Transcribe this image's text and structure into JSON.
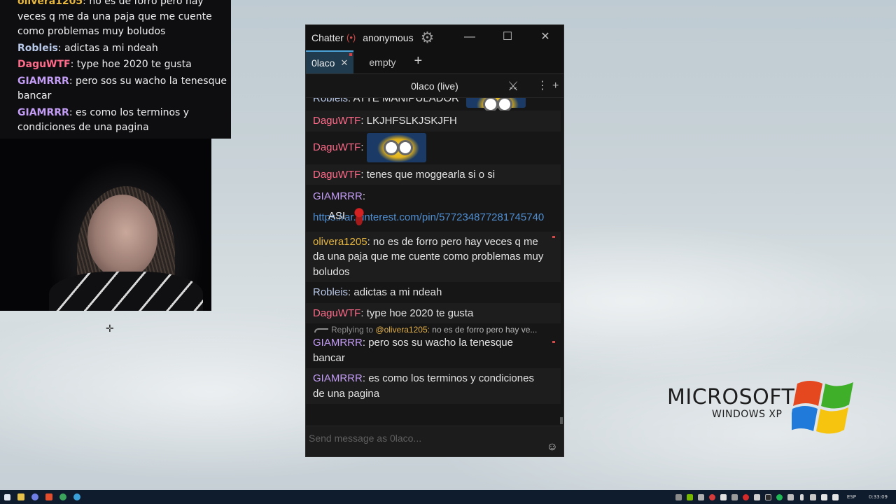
{
  "overlay": {
    "messages": [
      {
        "user": "olivera1205",
        "color": "#e6b63e",
        "sep": ": ",
        "text": "no es de forro pero hay veces q me da una paja que me cuente como problemas muy boludos"
      },
      {
        "user": "Robleis",
        "color": "#b8c8e8",
        "sep": ": ",
        "text": "adictas a mi ndeah"
      },
      {
        "user": "DaguWTF",
        "color": "#ff6b8a",
        "sep": ": ",
        "text": "type hoe 2020 te gusta"
      },
      {
        "user": "GIAMRRR",
        "color": "#c39cf5",
        "sep": ": ",
        "text": "pero sos su wacho la tenesque bancar"
      },
      {
        "user": "GIAMRRR",
        "color": "#c39cf5",
        "sep": ": ",
        "text": "es como los terminos y condiciones de una pagina"
      }
    ]
  },
  "window": {
    "app_name": "Chatterino",
    "user": "anonymous",
    "minimize": "—",
    "maximize": "☐",
    "close": "✕"
  },
  "tabs": [
    {
      "label": "0laco",
      "close": "✕"
    },
    {
      "label": "empty"
    }
  ],
  "add_tab": "+",
  "split": {
    "title": "0laco (live)",
    "more": "⋮",
    "add": "+"
  },
  "messages": {
    "cut": {
      "user": "Robleis",
      "sep": ": ",
      "text": "ATTE MANIPULADOR",
      "color": "#b8c8e8"
    },
    "m1": {
      "user": "DaguWTF",
      "sep": ": ",
      "text": "LKJHFSLKJSKJFH",
      "color": "#ff6b8a"
    },
    "m2": {
      "user": "DaguWTF",
      "sep": ": ",
      "color": "#ff6b8a"
    },
    "m3": {
      "user": "DaguWTF",
      "sep": ": ",
      "text": "tenes que moggearla si o si",
      "color": "#ff6b8a"
    },
    "m4": {
      "user": "GIAMRRR",
      "sep": ":",
      "link": "https://ar.pinterest.com/pin/577234877281745740",
      "text": "ASI",
      "color": "#c39cf5"
    },
    "m5": {
      "user": "olivera1205",
      "sep": ": ",
      "text": "no es de forro pero hay veces q me da una paja que me cuente como problemas muy boludos",
      "color": "#e6b63e"
    },
    "m6": {
      "user": "Robleis",
      "sep": ": ",
      "text": "adictas a mi ndeah",
      "color": "#b8c8e8"
    },
    "m7": {
      "user": "DaguWTF",
      "sep": ": ",
      "text": "type hoe 2020 te gusta",
      "color": "#ff6b8a"
    },
    "reply": {
      "prefix": "Replying to",
      "user": "@olivera1205:",
      "text": "no es de forro pero hay ve..."
    },
    "m8": {
      "user": "GIAMRRR",
      "sep": ": ",
      "text": "pero sos su wacho la tenesque bancar",
      "color": "#c39cf5"
    },
    "m9": {
      "user": "GIAMRRR",
      "sep": ": ",
      "text": "es como los terminos y condiciones de una pagina",
      "color": "#c39cf5"
    }
  },
  "input": {
    "placeholder": "Send message as 0laco..."
  },
  "xp": {
    "brand": "MICROSOFT",
    "product": "WINDOWS XP"
  },
  "taskbar": {
    "lang": "ESP",
    "clock": "0:33:09"
  }
}
